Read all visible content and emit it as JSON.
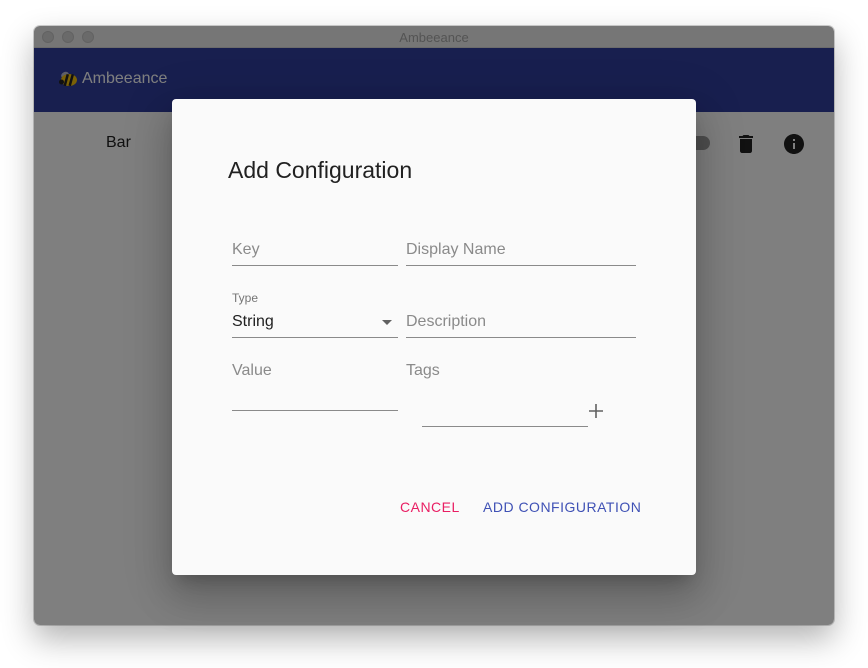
{
  "window": {
    "title": "Ambeeance"
  },
  "appbar": {
    "app_name": "Ambeeance",
    "icon": "bee-icon",
    "color": "#303f9f"
  },
  "list": {
    "rows": [
      {
        "name": "Bar"
      }
    ]
  },
  "dialog": {
    "title": "Add Configuration",
    "key_placeholder": "Key",
    "display_name_placeholder": "Display Name",
    "type_label": "Type",
    "type_value": "String",
    "description_placeholder": "Description",
    "value_label": "Value",
    "tags_label": "Tags",
    "cancel_label": "CANCEL",
    "add_label": "ADD CONFIGURATION"
  },
  "colors": {
    "primary": "#3f51b5",
    "secondary": "#e91e63"
  }
}
